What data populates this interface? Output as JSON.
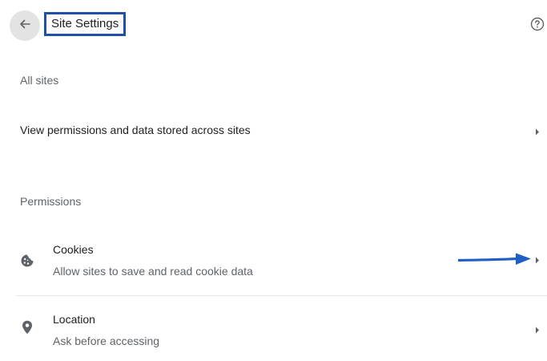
{
  "header": {
    "title": "Site Settings",
    "back_icon": "arrow-left-icon",
    "help_icon": "help-circle-icon"
  },
  "all_sites": {
    "heading": "All sites",
    "row_label": "View permissions and data stored across sites"
  },
  "permissions": {
    "heading": "Permissions",
    "items": [
      {
        "label": "Cookies",
        "description": "Allow sites to save and read cookie data",
        "icon": "cookie-icon"
      },
      {
        "label": "Location",
        "description": "Ask before accessing",
        "icon": "location-pin-icon"
      }
    ]
  },
  "colors": {
    "highlight_border": "#1f4fa6",
    "annotation_arrow": "#1f5fc4",
    "back_button_bg": "#e3e3e3"
  }
}
